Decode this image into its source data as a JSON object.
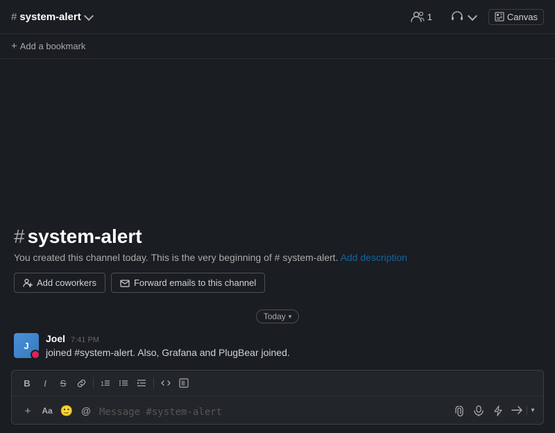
{
  "header": {
    "channel_hash": "#",
    "channel_name": "system-alert",
    "members_count": "1",
    "canvas_label": "Canvas"
  },
  "bookmark_bar": {
    "add_bookmark_label": "Add a bookmark"
  },
  "channel_intro": {
    "hash": "#",
    "title": "system-alert",
    "description": "You created this channel today. This is the very beginning of",
    "channel_ref": "# system-alert.",
    "add_description_label": "Add description",
    "add_coworkers_label": "Add coworkers",
    "forward_emails_label": "Forward emails to this channel"
  },
  "date_divider": {
    "label": "Today"
  },
  "messages": [
    {
      "author": "Joel",
      "time": "7:41 PM",
      "text": "joined #system-alert. Also, Grafana and PlugBear joined.",
      "avatar_initials": "J"
    }
  ],
  "input": {
    "placeholder": "Message #system-alert",
    "formatting": {
      "bold": "B",
      "italic": "I",
      "strikethrough": "S",
      "link": "🔗",
      "ordered_list": "ol",
      "unordered_list": "ul",
      "indent": "→",
      "code": "<>",
      "block": "⊡"
    },
    "actions": {
      "plus": "+",
      "text": "Aa",
      "emoji": "😊",
      "mention": "@",
      "attach": "📎",
      "audio": "🎤",
      "shortcuts": "⚡"
    }
  }
}
